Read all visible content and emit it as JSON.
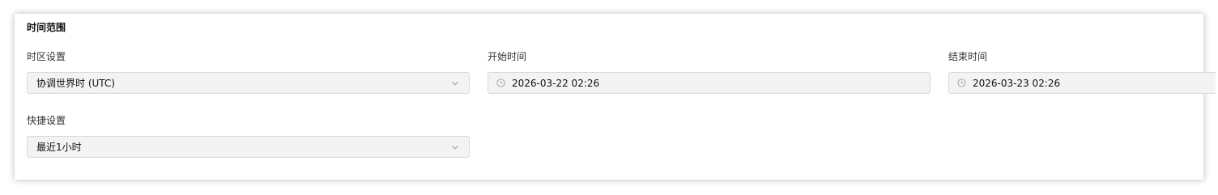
{
  "section": {
    "title": "时间范围"
  },
  "timezone": {
    "label": "时区设置",
    "value": "协调世界时 (UTC)"
  },
  "start_time": {
    "label": "开始时间",
    "value": "2026-03-22 02:26"
  },
  "end_time": {
    "label": "结束时间",
    "value": "2026-03-23 02:26"
  },
  "quick": {
    "label": "快捷设置",
    "value": "最近1小时"
  },
  "icons": {
    "select_arrow": "chevron-down-icon",
    "time_picker": "clock-icon"
  },
  "colors": {
    "control_bg": "#f3f3f3",
    "control_border": "#d9d9d9",
    "text": "#111111"
  }
}
